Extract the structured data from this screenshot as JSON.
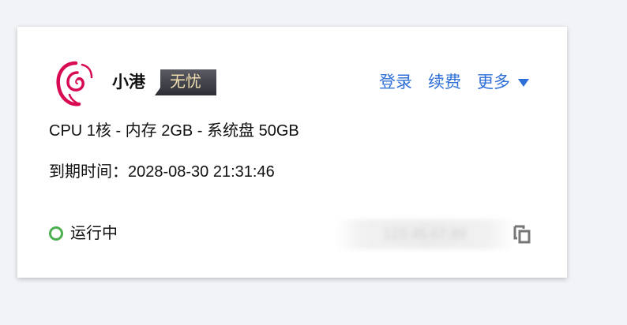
{
  "instance": {
    "name": "小港",
    "badge": "无忧",
    "os_logo_icon": "debian-swirl-icon",
    "actions": {
      "login": "登录",
      "renew": "续费",
      "more": "更多"
    },
    "specs": "CPU 1核 - 内存 2GB - 系统盘 50GB",
    "expiry_label": "到期时间：",
    "expiry_value": "2028-08-30 21:31:46",
    "status": "运行中",
    "ip_address": "123.45.67.89"
  },
  "colors": {
    "accent": "#2f6fd8",
    "status_running": "#4cb050",
    "badge_bg": "#3a3b42",
    "badge_text": "#f0dfb0",
    "debian_red": "#d70a53"
  }
}
